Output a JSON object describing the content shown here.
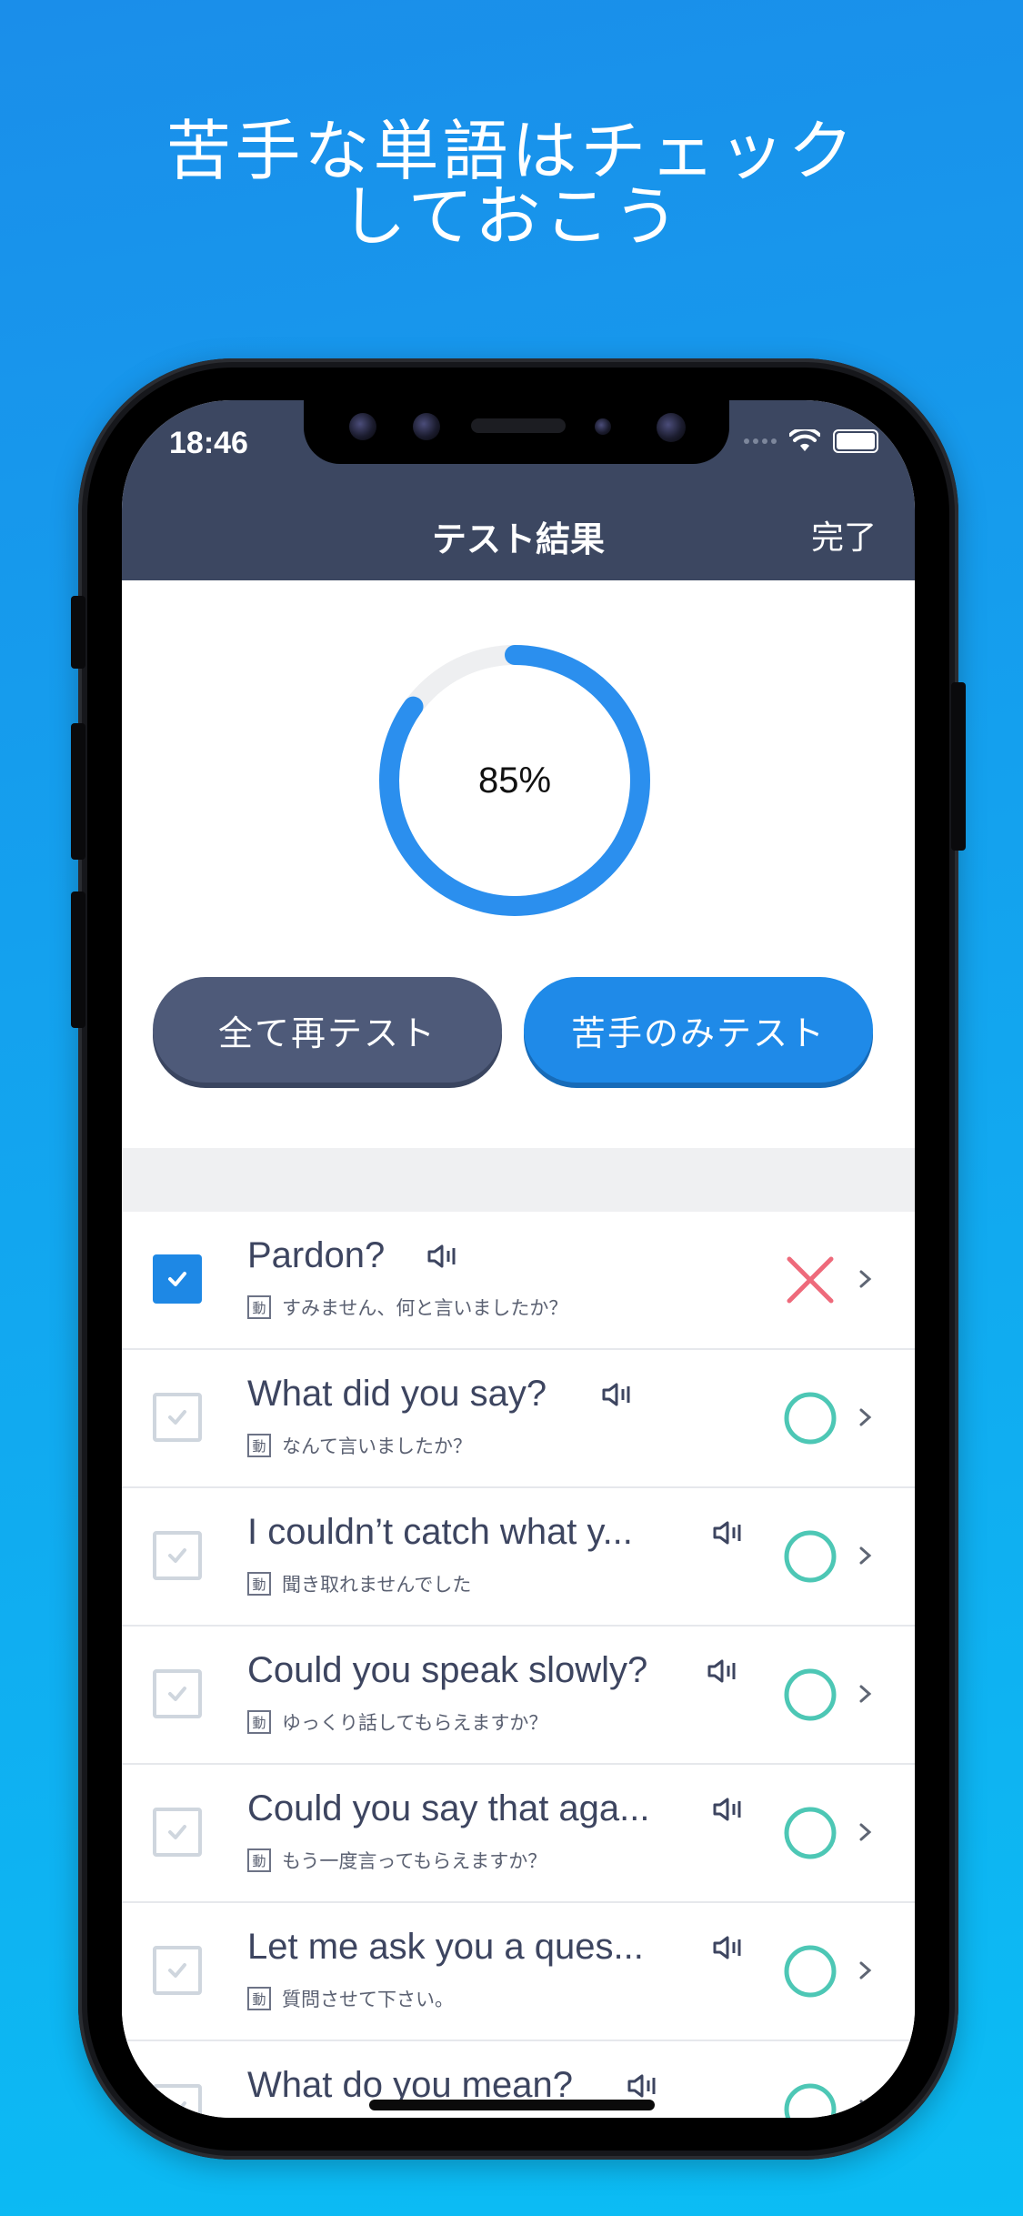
{
  "headline": [
    "苦手な単語はチェック",
    "しておこう"
  ],
  "status_bar": {
    "time": "18:46"
  },
  "nav": {
    "title": "テスト結果",
    "done": "完了"
  },
  "result": {
    "percent_label": "85%",
    "percent_value": 85
  },
  "buttons": {
    "retest_all": "全て再テスト",
    "retest_weak": "苦手のみテスト"
  },
  "colors": {
    "accent": "#1f8ae8",
    "nav_bg": "#3c4761",
    "correct": "#4dc7b5",
    "wrong": "#ee6a7b"
  },
  "rows": [
    {
      "en": "Pardon?",
      "pos": "動",
      "jp": "すみません、何と言いましたか？",
      "checked": true,
      "result": "wrong"
    },
    {
      "en": "What did you say?",
      "pos": "動",
      "jp": "なんて言いましたか？",
      "checked": false,
      "result": "correct"
    },
    {
      "en": "I couldn’t catch what y...",
      "pos": "動",
      "jp": "聞き取れませんでした",
      "checked": false,
      "result": "correct"
    },
    {
      "en": "Could you speak slowly?",
      "pos": "動",
      "jp": "ゆっくり話してもらえますか？",
      "checked": false,
      "result": "correct"
    },
    {
      "en": "Could you say that aga...",
      "pos": "動",
      "jp": "もう一度言ってもらえますか？",
      "checked": false,
      "result": "correct"
    },
    {
      "en": "Let me ask you a ques...",
      "pos": "動",
      "jp": "質問させて下さい。",
      "checked": false,
      "result": "correct"
    },
    {
      "en": "What do you mean?",
      "pos": "動",
      "jp": "",
      "checked": false,
      "result": "correct"
    }
  ]
}
